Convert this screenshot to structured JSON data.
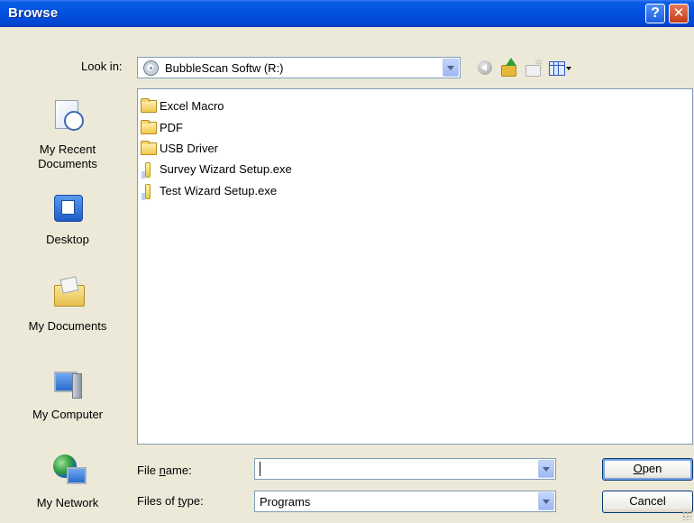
{
  "window": {
    "title": "Browse",
    "help_label": "?",
    "close_label": "✕"
  },
  "look_in": {
    "label": "Look in:",
    "value": "BubbleScan Softw (R:)"
  },
  "places": [
    {
      "label": "My Recent\nDocuments",
      "icon": "recent-documents-icon"
    },
    {
      "label": "Desktop",
      "icon": "desktop-icon"
    },
    {
      "label": "My Documents",
      "icon": "my-documents-icon"
    },
    {
      "label": "My Computer",
      "icon": "my-computer-icon"
    },
    {
      "label": "My Network",
      "icon": "my-network-icon"
    }
  ],
  "files": [
    {
      "name": "Excel Macro",
      "type": "folder"
    },
    {
      "name": "PDF",
      "type": "folder"
    },
    {
      "name": "USB Driver",
      "type": "folder"
    },
    {
      "name": "Survey Wizard Setup.exe",
      "type": "exe"
    },
    {
      "name": "Test Wizard Setup.exe",
      "type": "exe"
    }
  ],
  "file_name": {
    "label_pre": "File ",
    "label_ul": "n",
    "label_post": "ame:",
    "value": ""
  },
  "file_type": {
    "label_pre": "Files of ",
    "label_ul": "t",
    "label_post": "ype:",
    "value": "Programs"
  },
  "buttons": {
    "open_ul": "O",
    "open_rest": "pen",
    "cancel": "Cancel"
  }
}
